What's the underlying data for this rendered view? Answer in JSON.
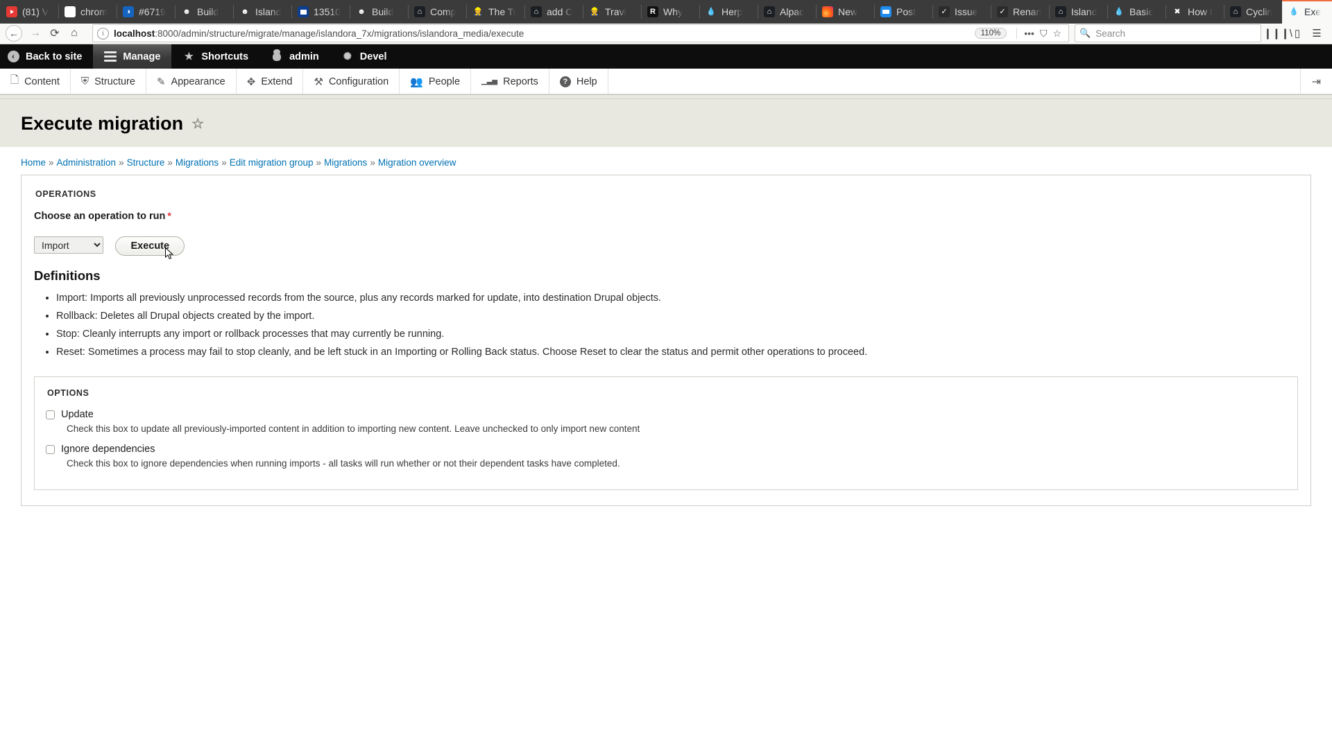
{
  "browser": {
    "tabs": [
      {
        "label": "(81) V",
        "icon": "youtube-icon",
        "icon_class": "fi-yt",
        "glyph": "",
        "active": false
      },
      {
        "label": "chrom",
        "icon": "google-icon",
        "icon_class": "fi-g",
        "glyph": "G",
        "active": false
      },
      {
        "label": "#6719",
        "icon": "circleci-icon",
        "icon_class": "fi-blue-circ",
        "glyph": "◑",
        "active": false
      },
      {
        "label": "Build",
        "icon": "travis-icon",
        "icon_class": "fi-green",
        "glyph": "☻",
        "active": false
      },
      {
        "label": "Island",
        "icon": "travis-icon",
        "icon_class": "fi-green",
        "glyph": "☻",
        "active": false
      },
      {
        "label": "13510",
        "icon": "window-icon",
        "icon_class": "fi-win",
        "glyph": "",
        "active": false
      },
      {
        "label": "Build",
        "icon": "travis-icon",
        "icon_class": "fi-red",
        "glyph": "☻",
        "active": false
      },
      {
        "label": "Comp",
        "icon": "github-icon",
        "icon_class": "fi-gh",
        "glyph": "⌂",
        "active": false
      },
      {
        "label": "The Tr",
        "icon": "construction-worker-icon",
        "icon_class": "fi-hat",
        "glyph": "👷",
        "active": false
      },
      {
        "label": "add C",
        "icon": "github-icon",
        "icon_class": "fi-gh",
        "glyph": "⌂",
        "active": false
      },
      {
        "label": "Travi",
        "icon": "construction-worker-icon",
        "icon_class": "fi-hat",
        "glyph": "👷",
        "active": false
      },
      {
        "label": "Why",
        "icon": "readme-icon",
        "icon_class": "fi-r",
        "glyph": "R",
        "active": false
      },
      {
        "label": "Herp",
        "icon": "drupal-icon",
        "icon_class": "fi-drupal",
        "glyph": "💧",
        "active": false
      },
      {
        "label": "Alpac",
        "icon": "github-icon",
        "icon_class": "fi-gh",
        "glyph": "⌂",
        "active": false
      },
      {
        "label": "New",
        "icon": "firefox-icon",
        "icon_class": "fi-ff",
        "glyph": "",
        "active": false
      },
      {
        "label": "Post ",
        "icon": "postman-icon",
        "icon_class": "fi-post",
        "glyph": "",
        "active": false
      },
      {
        "label": "Issue",
        "icon": "github-check-icon",
        "icon_class": "fi-ghc",
        "glyph": "✓",
        "active": false
      },
      {
        "label": "Renan",
        "icon": "github-check-icon",
        "icon_class": "fi-ghc",
        "glyph": "✓",
        "active": false
      },
      {
        "label": "Island",
        "icon": "github-icon",
        "icon_class": "fi-gh",
        "glyph": "⌂",
        "active": false
      },
      {
        "label": "Basic",
        "icon": "drupal-icon",
        "icon_class": "fi-drupal",
        "glyph": "💧",
        "active": false
      },
      {
        "label": "How t",
        "icon": "x-icon",
        "icon_class": "fi-x",
        "glyph": "✖",
        "active": false
      },
      {
        "label": "Cyclin",
        "icon": "github-icon",
        "icon_class": "fi-gh",
        "glyph": "⌂",
        "active": false
      },
      {
        "label": "Exe",
        "icon": "drupal-icon",
        "icon_class": "fi-drupal",
        "glyph": "💧",
        "active": true
      }
    ],
    "new_tab_label": "+",
    "tab_close_label": "✕",
    "nav": {
      "back": "←",
      "forward": "→",
      "reload": "⟳",
      "home": "⌂"
    },
    "url": {
      "host": "localhost",
      "path": ":8000/admin/structure/migrate/manage/islandora_7x/migrations/islandora_media/execute"
    },
    "zoom_level": "110%",
    "url_icons": {
      "more": "•••",
      "pocket": "⛉",
      "bookmark": "☆"
    },
    "search": {
      "placeholder": "Search",
      "icon": "🔍"
    },
    "right_icons": {
      "library": "❙❙❙\\",
      "sidebar": "▯",
      "menu": "☰"
    }
  },
  "drupal_toolbar": [
    {
      "label": "Back to site",
      "icon": "back-arrow-icon",
      "active": false
    },
    {
      "label": "Manage",
      "icon": "hamburger-icon",
      "active": true
    },
    {
      "label": "Shortcuts",
      "icon": "star-icon",
      "active": false
    },
    {
      "label": "admin",
      "icon": "user-icon",
      "active": false
    },
    {
      "label": "Devel",
      "icon": "gear-icon",
      "active": false
    }
  ],
  "drupal_menu": [
    {
      "label": "Content",
      "icon": "file-icon",
      "glyph": "🗋"
    },
    {
      "label": "Structure",
      "icon": "sitemap-icon",
      "glyph": "⛨"
    },
    {
      "label": "Appearance",
      "icon": "paintbrush-icon",
      "glyph": "✎"
    },
    {
      "label": "Extend",
      "icon": "puzzle-icon",
      "glyph": "✥"
    },
    {
      "label": "Configuration",
      "icon": "wrench-icon",
      "glyph": "⚒"
    },
    {
      "label": "People",
      "icon": "people-icon",
      "glyph": "👥"
    },
    {
      "label": "Reports",
      "icon": "bar-chart-icon",
      "glyph": "▁▃▅"
    },
    {
      "label": "Help",
      "icon": "question-mark-icon",
      "glyph": "?"
    }
  ],
  "drupal_menu_right_icon": "⇥",
  "page": {
    "title": "Execute migration",
    "star_icon": "☆",
    "breadcrumb": [
      {
        "label": "Home",
        "link": true
      },
      {
        "label": "Administration",
        "link": true
      },
      {
        "label": "Structure",
        "link": true
      },
      {
        "label": "Migrations",
        "link": true
      },
      {
        "label": "Edit migration group",
        "link": true
      },
      {
        "label": "Migrations",
        "link": true
      },
      {
        "label": "Migration overview",
        "link": true
      }
    ],
    "breadcrumb_separator": "»"
  },
  "operations": {
    "section_label": "Operations",
    "field_label": "Choose an operation to run",
    "required_marker": "*",
    "selected_option": "Import",
    "options": [
      "Import",
      "Rollback",
      "Stop",
      "Reset"
    ],
    "execute_button": "Execute",
    "definitions_heading": "Definitions",
    "definitions": [
      "Import: Imports all previously unprocessed records from the source, plus any records marked for update, into destination Drupal objects.",
      "Rollback: Deletes all Drupal objects created by the import.",
      "Stop: Cleanly interrupts any import or rollback processes that may currently be running.",
      "Reset: Sometimes a process may fail to stop cleanly, and be left stuck in an Importing or Rolling Back status. Choose Reset to clear the status and permit other operations to proceed."
    ]
  },
  "options": {
    "section_label": "Options",
    "items": [
      {
        "label": "Update",
        "checked": false,
        "description": "Check this box to update all previously-imported content in addition to importing new content. Leave unchecked to only import new content"
      },
      {
        "label": "Ignore dependencies",
        "checked": false,
        "description": "Check this box to ignore dependencies when running imports - all tasks will run whether or not their dependent tasks have completed."
      }
    ]
  }
}
